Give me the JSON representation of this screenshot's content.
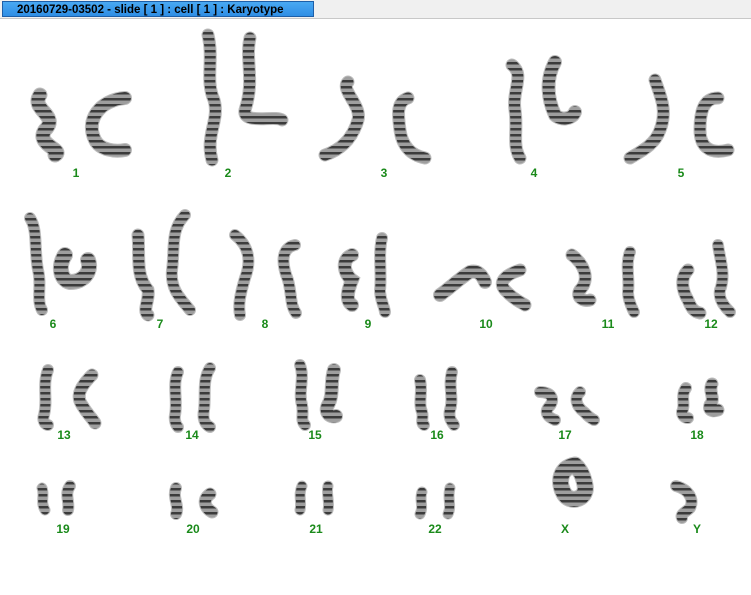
{
  "window": {
    "title": "20160729-03502 - slide [ 1 ] : cell [ 1 ] : Karyotype",
    "accent_color": "#2f8ee4"
  },
  "karyotype": {
    "label_color": "#1a8a1a",
    "chromosomes": [
      {
        "label": "1"
      },
      {
        "label": "2"
      },
      {
        "label": "3"
      },
      {
        "label": "4"
      },
      {
        "label": "5"
      },
      {
        "label": "6"
      },
      {
        "label": "7"
      },
      {
        "label": "8"
      },
      {
        "label": "9"
      },
      {
        "label": "10"
      },
      {
        "label": "11"
      },
      {
        "label": "12"
      },
      {
        "label": "13"
      },
      {
        "label": "14"
      },
      {
        "label": "15"
      },
      {
        "label": "16"
      },
      {
        "label": "17"
      },
      {
        "label": "18"
      },
      {
        "label": "19"
      },
      {
        "label": "20"
      },
      {
        "label": "21"
      },
      {
        "label": "22"
      },
      {
        "label": "X"
      },
      {
        "label": "Y"
      }
    ]
  }
}
